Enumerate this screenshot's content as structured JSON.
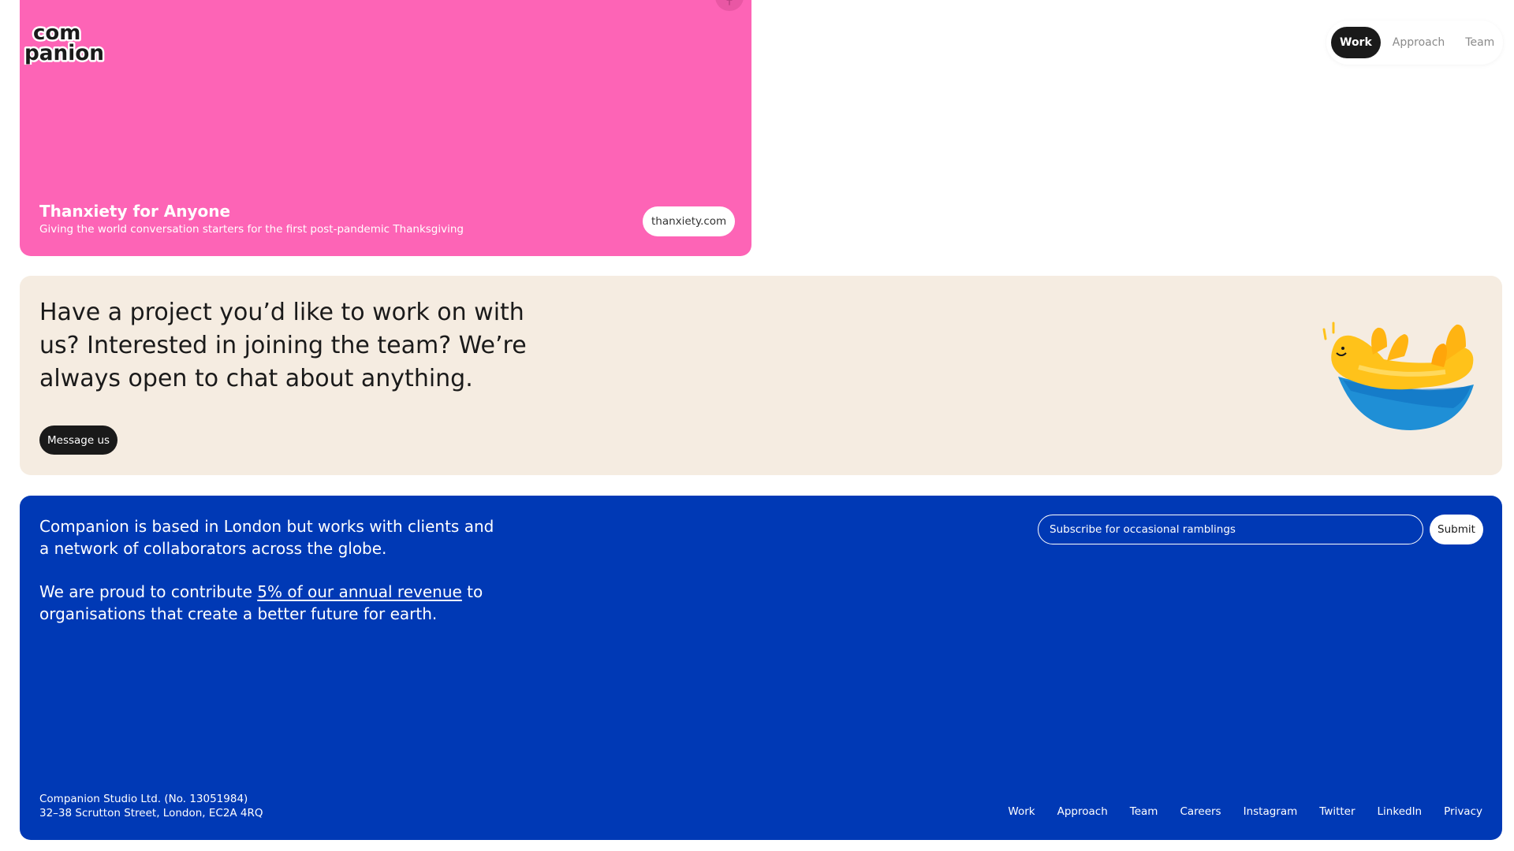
{
  "brand": {
    "logo_top": "com",
    "logo_bottom": "panion"
  },
  "nav": {
    "items": [
      {
        "label": "Work",
        "active": true
      },
      {
        "label": "Approach",
        "active": false
      },
      {
        "label": "Team",
        "active": false
      }
    ]
  },
  "project": {
    "title": "Thanxiety for Anyone",
    "description": "Giving the world conversation starters for the first post-pandemic Thanksgiving",
    "link": "thanxiety.com",
    "card_color": "#fd64b6"
  },
  "contact": {
    "text": "Have a project you’d like to work on with us? Interested in joining the team? We’re always open to chat about anything.",
    "button": "Message us",
    "panel_color": "#f5ece1"
  },
  "footer": {
    "about": "Companion is based in London but works with clients and a network of collaborators across the globe.",
    "proud_prefix": "We are proud to contribute ",
    "proud_link": "5% of our annual revenue",
    "proud_suffix": " to organisations that create a better future for earth.",
    "subscribe_placeholder": "Subscribe for occasional ramblings",
    "submit": "Submit",
    "company_line1": "Companion Studio Ltd. (No. 13051984)",
    "company_line2": "32–38 Scrutton Street, London, EC2A 4RQ",
    "links": [
      "Work",
      "Approach",
      "Team",
      "Careers",
      "Instagram",
      "Twitter",
      "LinkedIn",
      "Privacy"
    ],
    "bg_color": "#0039b5"
  }
}
